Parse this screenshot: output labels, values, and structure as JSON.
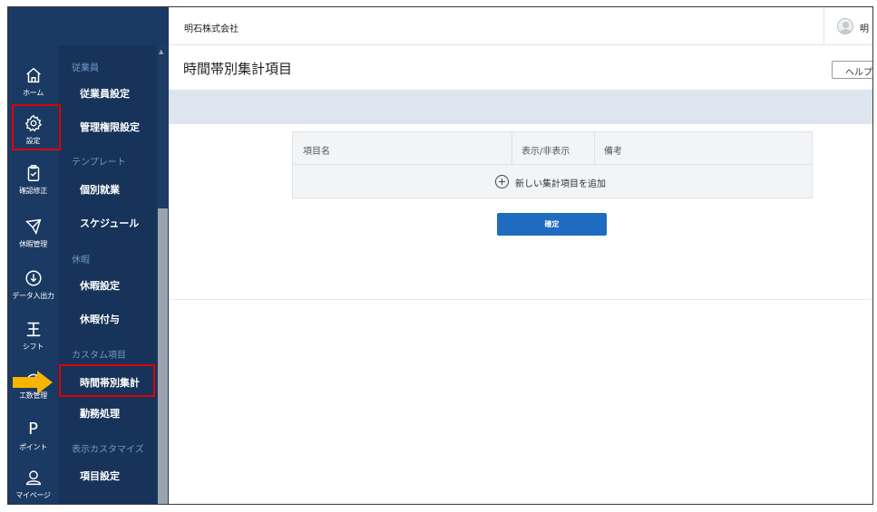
{
  "header": {
    "company": "明石株式会社",
    "user_name": "明"
  },
  "rail": {
    "home": "ホーム",
    "settings": "設定",
    "confirm_edit": "確認修正",
    "leave_mgmt": "休暇管理",
    "data_io": "データ入出力",
    "shift": "シフト",
    "work_mgmt": "工数管理",
    "point_letter": "P",
    "point": "ポイント",
    "mypage": "マイページ"
  },
  "submenu": {
    "sec_employee": "従業員",
    "employee_settings": "従業員設定",
    "admin_settings": "管理権限設定",
    "sec_template": "テンプレート",
    "individual_work": "個別就業",
    "schedule": "スケジュール",
    "sec_leave": "休暇",
    "leave_settings": "休暇設定",
    "leave_grant": "休暇付与",
    "sec_custom": "カスタム項目",
    "hourly_total": "時間帯別集計",
    "work_process": "勤務処理",
    "sec_display": "表示カスタマイズ",
    "item_settings": "項目設定"
  },
  "main": {
    "title": "時間帯別集計項目",
    "help": "ヘルプ",
    "table": {
      "col_name": "項目名",
      "col_visible": "表示/非表示",
      "col_note": "備考"
    },
    "add_label": "新しい集計項目を追加",
    "confirm": "確定"
  },
  "colors": {
    "sidebar": "#1b3a63",
    "submenu": "#17335a",
    "accent": "#1f6bbf",
    "highlight": "#e00000",
    "arrow": "#f7b500"
  }
}
